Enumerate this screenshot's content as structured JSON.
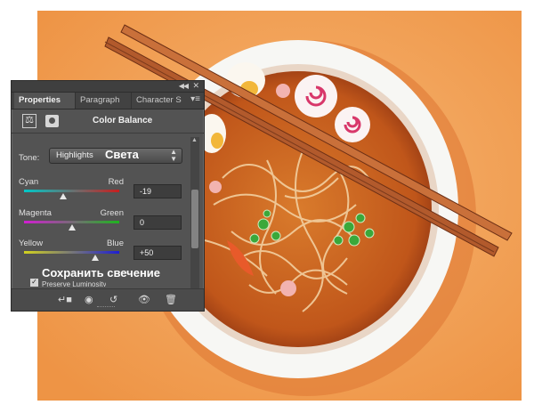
{
  "panel": {
    "tabs": [
      {
        "label": "Properties",
        "active": true
      },
      {
        "label": "Paragraph",
        "active": false
      },
      {
        "label": "Character S",
        "active": false
      }
    ],
    "collapse_icon": "double-chevron-icon",
    "close_icon": "close-icon",
    "menu_icon": "panel-menu-icon",
    "adjustment_title": "Color Balance",
    "tone": {
      "label": "Tone:",
      "value": "Highlights",
      "annotation": "Света"
    },
    "sliders": [
      {
        "left": "Cyan",
        "right": "Red",
        "value": "-19",
        "fraction": 0.41,
        "gradient": [
          "#00c8c8",
          "#c81e1e"
        ]
      },
      {
        "left": "Magenta",
        "right": "Green",
        "value": "0",
        "fraction": 0.5,
        "gradient": [
          "#d21ed2",
          "#1eb41e"
        ]
      },
      {
        "left": "Yellow",
        "right": "Blue",
        "value": "+50",
        "fraction": 0.75,
        "gradient": [
          "#d2d21e",
          "#1e1ed2"
        ]
      }
    ],
    "preserve": {
      "annotation": "Сохранить свечение",
      "label": "Preserve Luminosity",
      "checked": true
    },
    "bottom_icons": [
      "clip-to-layer-icon",
      "view-previous-icon",
      "reset-icon",
      "visibility-eye-icon",
      "trash-icon"
    ]
  },
  "colors": {
    "panel_bg": "#535353",
    "background_orange": "#f2a35a",
    "bowl_white": "#f7f7f4",
    "broth": "#c8621e",
    "chopsticks": "#b0582a"
  }
}
